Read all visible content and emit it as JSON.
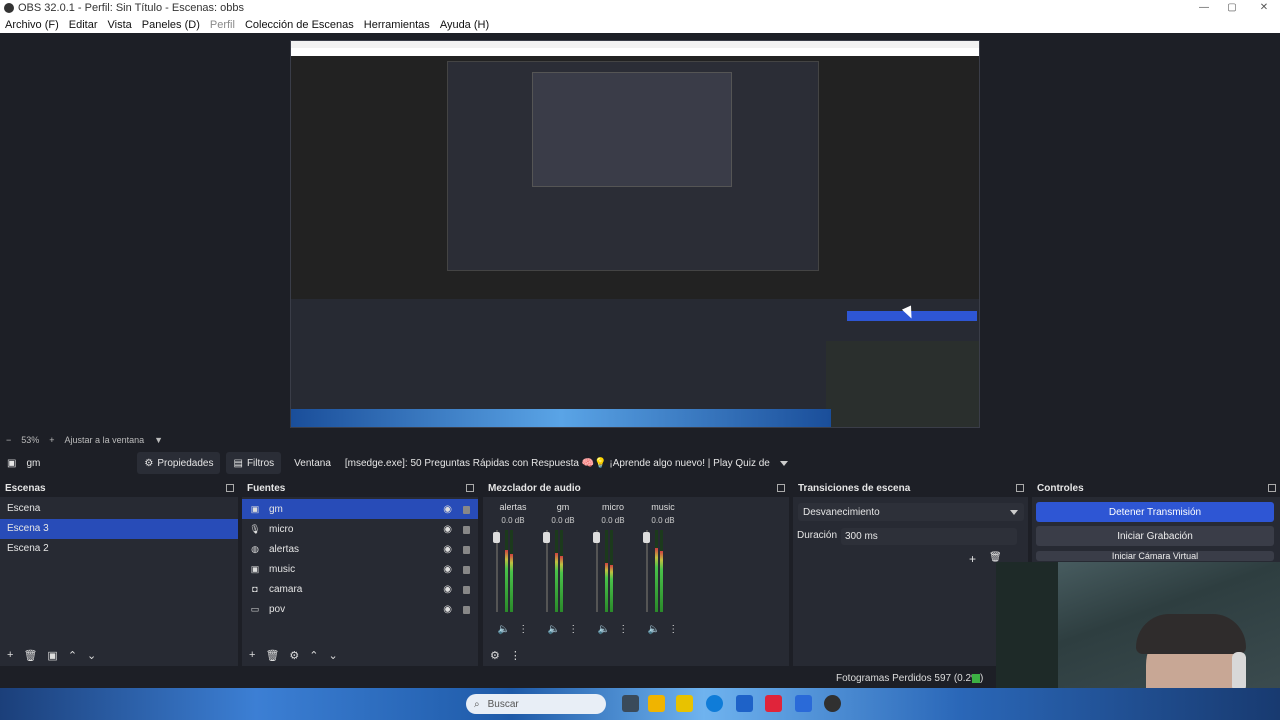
{
  "window": {
    "title": "OBS 32.0.1 - Perfil: Sin Título - Escenas: obbs"
  },
  "menu": [
    "Archivo (F)",
    "Editar",
    "Vista",
    "Paneles (D)",
    "Perfil",
    "Colección de Escenas",
    "Herramientas",
    "Ayuda (H)"
  ],
  "zoom": {
    "level": "53%",
    "fit_label": "Ajustar a la ventana"
  },
  "source_toolbar": {
    "selected_source": "gm",
    "properties": "Propiedades",
    "filters": "Filtros",
    "window_label": "Ventana",
    "window_value": "[msedge.exe]: 50 Preguntas Rápidas con Respuesta 🧠💡 ¡Aprende algo nuevo! | Play Quiz de"
  },
  "scenes": {
    "title": "Escenas",
    "items": [
      "Escena",
      "Escena 3",
      "Escena 2"
    ],
    "selected": "Escena 3"
  },
  "sources": {
    "title": "Fuentes",
    "items": [
      {
        "name": "gm",
        "icon": "window-capture-icon"
      },
      {
        "name": "micro",
        "icon": "microphone-icon"
      },
      {
        "name": "alertas",
        "icon": "browser-icon"
      },
      {
        "name": "music",
        "icon": "window-capture-icon"
      },
      {
        "name": "camara",
        "icon": "camera-icon"
      },
      {
        "name": "pov",
        "icon": "monitor-icon"
      }
    ],
    "selected": "gm"
  },
  "mixer": {
    "title": "Mezclador de audio",
    "channels": [
      {
        "name": "alertas",
        "db": "0.0 dB",
        "level": 0.75
      },
      {
        "name": "gm",
        "db": "0.0 dB",
        "level": 0.72
      },
      {
        "name": "micro",
        "db": "0.0 dB",
        "level": 0.6
      },
      {
        "name": "music",
        "db": "0.0 dB",
        "level": 0.78
      }
    ]
  },
  "transitions": {
    "title": "Transiciones de escena",
    "selected": "Desvanecimiento",
    "duration_label": "Duración",
    "duration_value": "300 ms"
  },
  "controls": {
    "title": "Controles",
    "stop_stream": "Detener Transmisión",
    "start_record": "Iniciar Grabación",
    "virtual_cam": "Iniciar Cámara Virtual"
  },
  "status": {
    "dropped_frames": "Fotogramas Perdidos 597 (0.2%)"
  },
  "taskbar": {
    "search_placeholder": "Buscar"
  },
  "colors": {
    "accent": "#284cb8",
    "button_active": "#2e56d4",
    "panel_bg": "#272a33",
    "bg": "#1d1f26"
  }
}
